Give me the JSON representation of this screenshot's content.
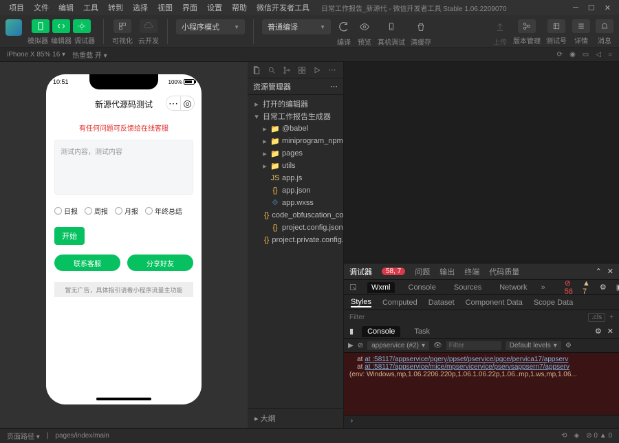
{
  "menubar": {
    "items": [
      "项目",
      "文件",
      "编辑",
      "工具",
      "转到",
      "选择",
      "视图",
      "界面",
      "设置",
      "帮助",
      "微信开发者工具"
    ],
    "project": "日常工作报告_新源代",
    "suffix": " - 微信开发者工具 Stable 1.06.2209070"
  },
  "toolbar": {
    "labels": {
      "simulator": "模拟器",
      "editor": "编辑器",
      "debugger": "调试器",
      "visual": "可视化",
      "cloud": "云开发"
    },
    "mode": "小程序模式",
    "compile": "普通编译",
    "actions": {
      "compile": "编译",
      "preview": "预览",
      "remote": "真机调试",
      "clear": "清缓存",
      "upload": "上传",
      "version": "版本管理",
      "testnum": "测试号",
      "detail": "详情",
      "message": "消息"
    }
  },
  "status": {
    "device": "iPhone X 85% 16",
    "render": "热重载 开"
  },
  "sim": {
    "time": "10:51",
    "battery": "100%",
    "title": "新源代源码测试",
    "notice": "有任何问题可反馈给在线客服",
    "placeholder": "测试内容，测试内容",
    "radios": [
      "日报",
      "周报",
      "月报",
      "年终总结"
    ],
    "start": "开始",
    "contact": "联系客服",
    "share": "分享好友",
    "ad": "暂无广告，具体指引请看小程序流量主功能"
  },
  "explorer": {
    "title": "资源管理器",
    "sections": [
      "打开的编辑器",
      "日常工作报告生成器"
    ],
    "tree": [
      {
        "name": "@babel",
        "icon": "folder",
        "indent": 1,
        "tw": "▸"
      },
      {
        "name": "miniprogram_npm",
        "icon": "folder",
        "indent": 1,
        "tw": "▸"
      },
      {
        "name": "pages",
        "icon": "folder-red",
        "indent": 1,
        "tw": "▸"
      },
      {
        "name": "utils",
        "icon": "folder-grn",
        "indent": 1,
        "tw": "▸"
      },
      {
        "name": "app.js",
        "icon": "js",
        "indent": 1,
        "tw": ""
      },
      {
        "name": "app.json",
        "icon": "json",
        "indent": 1,
        "tw": ""
      },
      {
        "name": "app.wxss",
        "icon": "wxss",
        "indent": 1,
        "tw": ""
      },
      {
        "name": "code_obfuscation_conf...",
        "icon": "json",
        "indent": 1,
        "tw": ""
      },
      {
        "name": "project.config.json",
        "icon": "json",
        "indent": 1,
        "tw": ""
      },
      {
        "name": "project.private.config.js...",
        "icon": "json",
        "indent": 1,
        "tw": ""
      }
    ],
    "outline": "大纲"
  },
  "dev": {
    "tabs": {
      "debugger": "调试器",
      "badge": "58, 7",
      "problems": "问题",
      "output": "输出",
      "terminal": "终端",
      "quality": "代码质量"
    },
    "sub": {
      "wxml": "Wxml",
      "console": "Console",
      "sources": "Sources",
      "network": "Network",
      "err": "58",
      "warn": "7"
    },
    "styles": {
      "tabs": [
        "Styles",
        "Computed",
        "Dataset",
        "Component Data",
        "Scope Data"
      ],
      "filter": "Filter",
      "cls": ".cls"
    },
    "console": {
      "tabs": [
        "Console",
        "Task"
      ],
      "context": "appservice (#2)",
      "filterPh": "Filter",
      "levels": "Default levels",
      "lines": [
        "at :58117/appservice/pgery/ppset/pservice/pgce/pervica17/appserv",
        "at :58117/appservice/mice/mpservicervice/pservsappsern7/appserv"
      ],
      "env": "(env: Windows,mp,1.06.2206.220p,1.06.1.06.22p,1.06..mp,1.ws,mp,1.06..."
    }
  },
  "footer": {
    "path_label": "页面路径",
    "path": "pages/index/main",
    "errs": "0",
    "warns": "0"
  }
}
